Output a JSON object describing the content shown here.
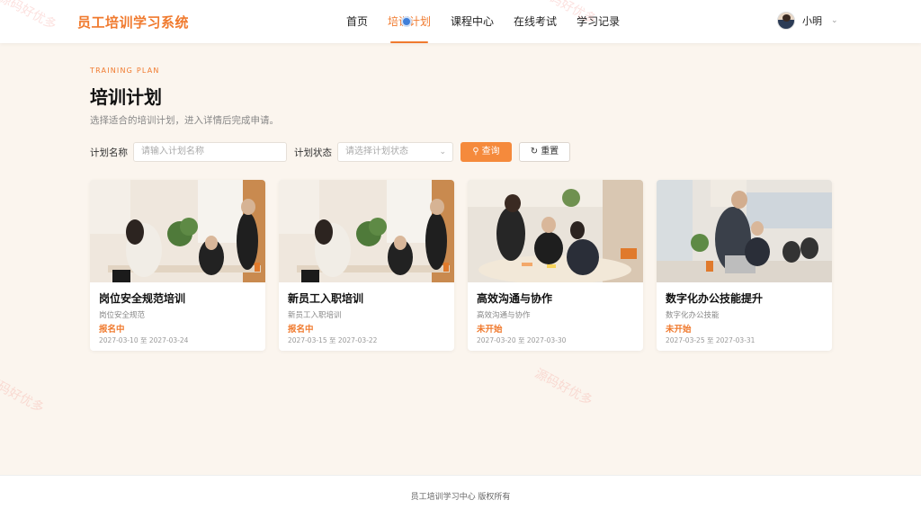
{
  "header": {
    "brand": "员工培训学习系统",
    "nav": [
      {
        "label": "首页",
        "active": false
      },
      {
        "label": "培训计划",
        "active": true
      },
      {
        "label": "课程中心",
        "active": false
      },
      {
        "label": "在线考试",
        "active": false
      },
      {
        "label": "学习记录",
        "active": false
      }
    ],
    "user": {
      "name": "小明"
    }
  },
  "hero": {
    "eyebrow": "TRAINING PLAN",
    "title": "培训计划",
    "description": "选择适合的培训计划，进入详情后完成申请。"
  },
  "filter": {
    "name_label": "计划名称",
    "name_placeholder": "请输入计划名称",
    "status_label": "计划状态",
    "status_placeholder": "请选择计划状态",
    "search_label": "查询",
    "reset_label": "重置"
  },
  "plans": [
    {
      "title": "岗位安全规范培训",
      "subtitle": "岗位安全规范",
      "status": "报名中",
      "date": "2027-03-10 至 2027-03-24"
    },
    {
      "title": "新员工入职培训",
      "subtitle": "新员工入职培训",
      "status": "报名中",
      "date": "2027-03-15 至 2027-03-22"
    },
    {
      "title": "高效沟通与协作",
      "subtitle": "高效沟通与协作",
      "status": "未开始",
      "date": "2027-03-20 至 2027-03-30"
    },
    {
      "title": "数字化办公技能提升",
      "subtitle": "数字化办公技能",
      "status": "未开始",
      "date": "2027-03-25 至 2027-03-31"
    }
  ],
  "watermark": "源码好优多",
  "footer": {
    "text": "员工培训学习中心 版权所有"
  },
  "colors": {
    "accent": "#f07a2e",
    "background": "#fbf5ee",
    "primary_button": "#f58a3c"
  }
}
